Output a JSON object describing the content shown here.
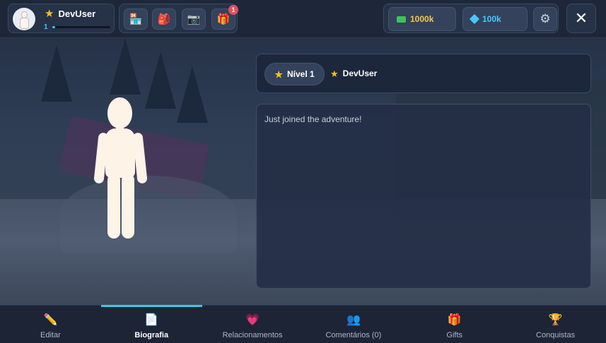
{
  "header": {
    "profile": {
      "name": "DevUser",
      "level": "1",
      "xp_progress": 0.05
    },
    "quick_icons": [
      {
        "name": "shop-icon",
        "glyph": "🏪"
      },
      {
        "name": "backpack-icon",
        "glyph": "🎒"
      },
      {
        "name": "camera-icon",
        "glyph": "📷"
      },
      {
        "name": "gift-icon",
        "glyph": "🎁",
        "badge": "1"
      }
    ],
    "currency": {
      "cash": "1000k",
      "gems": "100k"
    }
  },
  "info": {
    "level_label": "Nível 1",
    "name": "DevUser"
  },
  "bio": {
    "text": "Just joined the adventure!"
  },
  "tabs": [
    {
      "label": "Editar",
      "icon": "pencil-icon",
      "glyph": "✏️",
      "active": false
    },
    {
      "label": "Biografia",
      "icon": "document-icon",
      "glyph": "📄",
      "active": true
    },
    {
      "label": "Relacionamentos",
      "icon": "heart-icon",
      "glyph": "💗",
      "active": false
    },
    {
      "label": "Comentários (0)",
      "icon": "users-icon",
      "glyph": "👥",
      "active": false
    },
    {
      "label": "Gifts",
      "icon": "gift-icon",
      "glyph": "🎁",
      "active": false
    },
    {
      "label": "Conquistas",
      "icon": "trophy-icon",
      "glyph": "🏆",
      "active": false
    }
  ],
  "colors": {
    "accent": "#3ec7e6",
    "cash": "#f2c94c",
    "gems": "#46c7ff",
    "star": "#f4c21b",
    "badge": "#e0505f"
  }
}
